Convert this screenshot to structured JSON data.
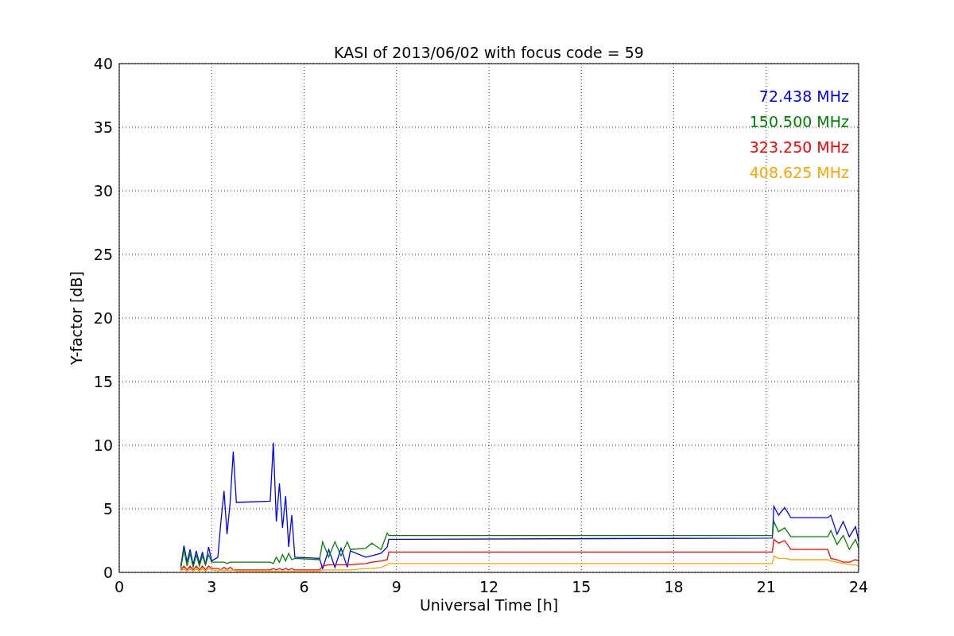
{
  "figure": {
    "chart_data": {
      "type": "line",
      "title": "KASI of 2013/06/02 with focus code = 59",
      "xlabel": "Universal Time [h]",
      "ylabel": "Y-factor [dB]",
      "xlim": [
        0,
        24
      ],
      "ylim": [
        0,
        40
      ],
      "xticks": [
        0,
        3,
        6,
        9,
        12,
        15,
        18,
        21,
        24
      ],
      "yticks": [
        0,
        5,
        10,
        15,
        20,
        25,
        30,
        35,
        40
      ],
      "grid": true,
      "x": [
        2.0,
        2.1,
        2.2,
        2.3,
        2.4,
        2.5,
        2.6,
        2.7,
        2.8,
        2.9,
        3.0,
        3.2,
        3.3,
        3.4,
        3.5,
        3.6,
        3.7,
        3.8,
        4.9,
        5.0,
        5.1,
        5.2,
        5.3,
        5.4,
        5.5,
        5.6,
        5.7,
        6.5,
        6.6,
        6.8,
        7.0,
        7.2,
        7.4,
        7.5,
        8.0,
        8.2,
        8.5,
        8.7,
        8.75,
        21.2,
        21.25,
        21.4,
        21.6,
        21.8,
        23.0,
        23.1,
        23.3,
        23.5,
        23.7,
        23.9,
        24.0
      ],
      "series": [
        {
          "name": "72.438 MHz",
          "color": "#0000ff",
          "values": [
            0.5,
            2.1,
            0.8,
            1.8,
            0.6,
            1.7,
            0.7,
            1.6,
            0.6,
            2.0,
            0.9,
            1.2,
            4.0,
            6.4,
            3.0,
            5.5,
            9.5,
            5.5,
            5.6,
            10.2,
            4.0,
            7.0,
            3.5,
            6.0,
            2.0,
            4.5,
            1.2,
            1.1,
            0.3,
            1.8,
            0.4,
            1.9,
            0.4,
            1.7,
            1.2,
            1.3,
            1.5,
            2.0,
            2.6,
            2.7,
            5.2,
            4.5,
            5.1,
            4.3,
            4.3,
            4.5,
            3.0,
            4.0,
            2.8,
            3.6,
            2.5
          ]
        },
        {
          "name": "150.500 MHz",
          "color": "#008000",
          "values": [
            0.3,
            1.8,
            0.5,
            1.5,
            0.4,
            1.4,
            0.5,
            1.3,
            0.6,
            1.4,
            0.8,
            0.8,
            0.8,
            0.8,
            0.7,
            0.8,
            0.8,
            0.8,
            0.8,
            0.7,
            1.2,
            0.8,
            1.4,
            0.9,
            1.5,
            1.0,
            1.1,
            1.0,
            2.4,
            1.2,
            2.4,
            1.3,
            2.4,
            1.8,
            1.9,
            2.3,
            1.8,
            3.1,
            2.9,
            2.9,
            4.0,
            3.2,
            3.5,
            2.8,
            2.8,
            3.3,
            2.2,
            2.9,
            1.8,
            2.6,
            1.9
          ]
        },
        {
          "name": "323.250 MHz",
          "color": "#ff0000",
          "values": [
            0.2,
            0.5,
            0.2,
            0.5,
            0.2,
            0.5,
            0.2,
            0.5,
            0.2,
            0.5,
            0.3,
            0.3,
            0.2,
            0.4,
            0.2,
            0.4,
            0.2,
            0.2,
            0.2,
            0.3,
            0.2,
            0.3,
            0.2,
            0.3,
            0.2,
            0.3,
            0.2,
            0.2,
            0.5,
            0.6,
            0.6,
            0.6,
            0.6,
            0.6,
            0.7,
            0.8,
            0.9,
            1.0,
            1.6,
            1.6,
            2.6,
            2.3,
            2.5,
            1.8,
            1.8,
            1.1,
            1.0,
            0.8,
            0.8,
            1.0,
            0.9
          ]
        },
        {
          "name": "408.625 MHz",
          "color": "#ffa500",
          "values": [
            0.1,
            0.3,
            0.1,
            0.3,
            0.1,
            0.3,
            0.1,
            0.3,
            0.1,
            0.3,
            0.2,
            0.1,
            0.2,
            0.1,
            0.2,
            0.1,
            0.2,
            0.1,
            0.1,
            0.1,
            0.1,
            0.1,
            0.1,
            0.1,
            0.1,
            0.1,
            0.1,
            0.1,
            0.2,
            0.2,
            0.2,
            0.2,
            0.2,
            0.2,
            0.3,
            0.3,
            0.4,
            0.6,
            0.7,
            0.7,
            1.3,
            1.1,
            1.1,
            1.0,
            1.0,
            0.9,
            0.8,
            0.7,
            0.6,
            0.6,
            0.5
          ]
        }
      ]
    }
  }
}
